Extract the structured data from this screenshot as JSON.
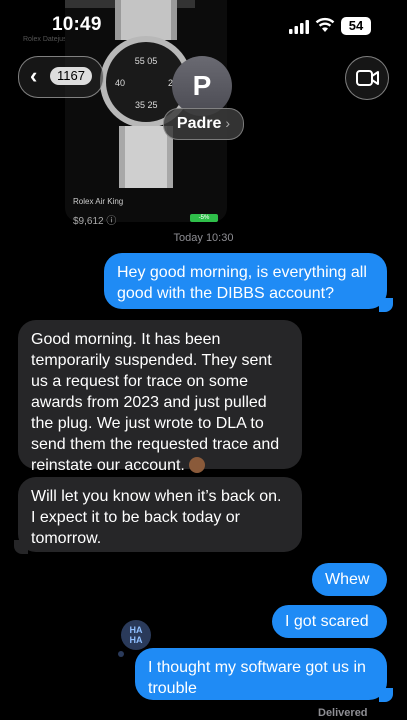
{
  "status_bar": {
    "time": "10:49",
    "battery": "54"
  },
  "background_photo": {
    "side_label": "Rolex Datejust",
    "product_name": "Rolex Air King",
    "price": "$9,612 ⓘ",
    "tag": "-5%"
  },
  "header": {
    "back_count": "1167",
    "avatar_initial": "P",
    "contact_name": "Padre"
  },
  "timestamp": {
    "day": "Today",
    "time": "10:30"
  },
  "messages": [
    {
      "from": "me",
      "text": "Hey good morning, is everything all good with the DIBBS account?"
    },
    {
      "from": "them",
      "text": "Good morning. It has been temporarily suspended. They sent us a request for trace on some awards from 2023 and just pulled the plug. We just wrote to DLA to send them the requested trace and reinstate our account."
    },
    {
      "from": "them",
      "text": "Will let you know when it’s back on. I expect it to be back today or tomorrow."
    },
    {
      "from": "me",
      "text": "Whew"
    },
    {
      "from": "me",
      "text": "I got scared"
    },
    {
      "from": "me",
      "text": "I thought my software got us in trouble"
    }
  ],
  "reaction": {
    "line1": "HA",
    "line2": "HA"
  },
  "delivered_label": "Delivered",
  "colors": {
    "outgoing": "#1f8bf5",
    "incoming": "#262628",
    "background": "#000000"
  }
}
